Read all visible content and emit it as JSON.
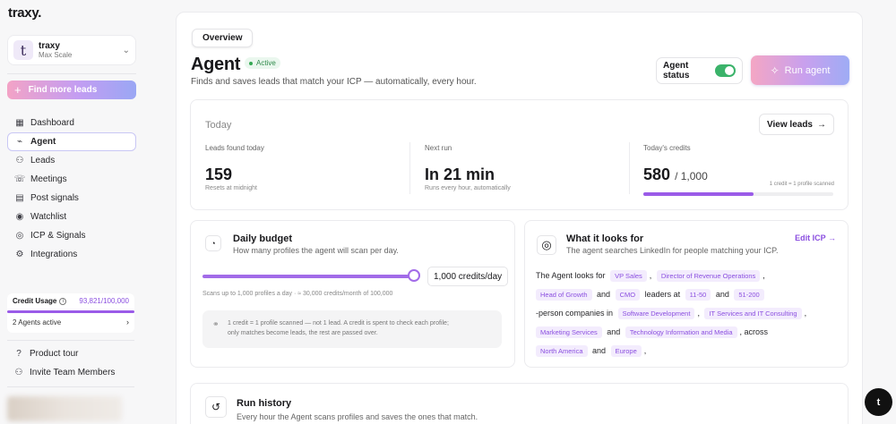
{
  "app": {
    "logo": "traxy."
  },
  "account": {
    "avatar_letter": "t",
    "name": "traxy",
    "plan": "Max Scale"
  },
  "sidebar": {
    "find_leads": "Find more leads",
    "items": [
      {
        "label": "Dashboard",
        "icon": "grid-icon"
      },
      {
        "label": "Agent",
        "icon": "bot-icon",
        "active": true
      },
      {
        "label": "Leads",
        "icon": "users-icon"
      },
      {
        "label": "Meetings",
        "icon": "chat-icon"
      },
      {
        "label": "Post signals",
        "icon": "calendar-icon"
      },
      {
        "label": "Watchlist",
        "icon": "eye-icon"
      },
      {
        "label": "ICP & Signals",
        "icon": "target-icon"
      },
      {
        "label": "Integrations",
        "icon": "plug-icon"
      }
    ],
    "credit_usage": {
      "label": "Credit Usage",
      "value": "93,821/100,000",
      "agents": "2 Agents active"
    },
    "footer": {
      "product_tour": "Product tour",
      "invite": "Invite Team Members"
    }
  },
  "header": {
    "tab": "Overview",
    "title": "Agent",
    "badge": "Active",
    "subtitle": "Finds and saves leads that match your ICP — automatically, every hour.",
    "status_label": "Agent status",
    "status_on": true,
    "run_label": "Run agent"
  },
  "today": {
    "heading": "Today",
    "view_leads": "View leads",
    "leads": {
      "label": "Leads found today",
      "value": "159",
      "note": "Resets at midnight"
    },
    "next_run": {
      "label": "Next run",
      "value": "In 21 min",
      "note": "Runs every hour, automatically"
    },
    "credits": {
      "label": "Today's credits",
      "used": "580",
      "total": "/ 1,000",
      "note": "1 credit = 1 profile scanned",
      "fraction": 0.58
    }
  },
  "budget": {
    "title": "Daily budget",
    "subtitle": "How many profiles the agent will scan per day.",
    "value": "1,000 credits/day",
    "note": "Scans up to 1,000 profiles a day · ≈ 30,000 credits/month of 100,000",
    "info_line1": "1 credit = 1 profile scanned — not 1 lead. A credit is spent to check each profile;",
    "info_line2": "only matches become leads, the rest are passed over."
  },
  "looks": {
    "title": "What it looks for",
    "subtitle": "The agent searches LinkedIn for people matching your ICP.",
    "edit": "Edit ICP",
    "t_intro": "The Agent looks for",
    "c_vp": "VP Sales",
    "c_dir": "Director of Revenue Operations",
    "c_head": "Head of Growth",
    "t_and1": "and",
    "c_cmo": "CMO",
    "t_leaders": "leaders at",
    "c_1150": "11-50",
    "t_and2": "and",
    "c_51200": "51-200",
    "t_person": "-person companies in",
    "c_soft": "Software Development",
    "c_it": "IT Services and IT Consulting",
    "c_mkt": "Marketing Services",
    "t_and3": "and",
    "c_tech": "Technology Information and Media",
    "t_across": ", across",
    "c_na": "North America",
    "t_and4": "and",
    "c_eu": "Europe",
    "comma": ",",
    "end": ","
  },
  "history": {
    "title": "Run history",
    "subtitle": "Every hour the Agent scans profiles and saves the ones that match."
  },
  "fab": {
    "label": "t"
  }
}
